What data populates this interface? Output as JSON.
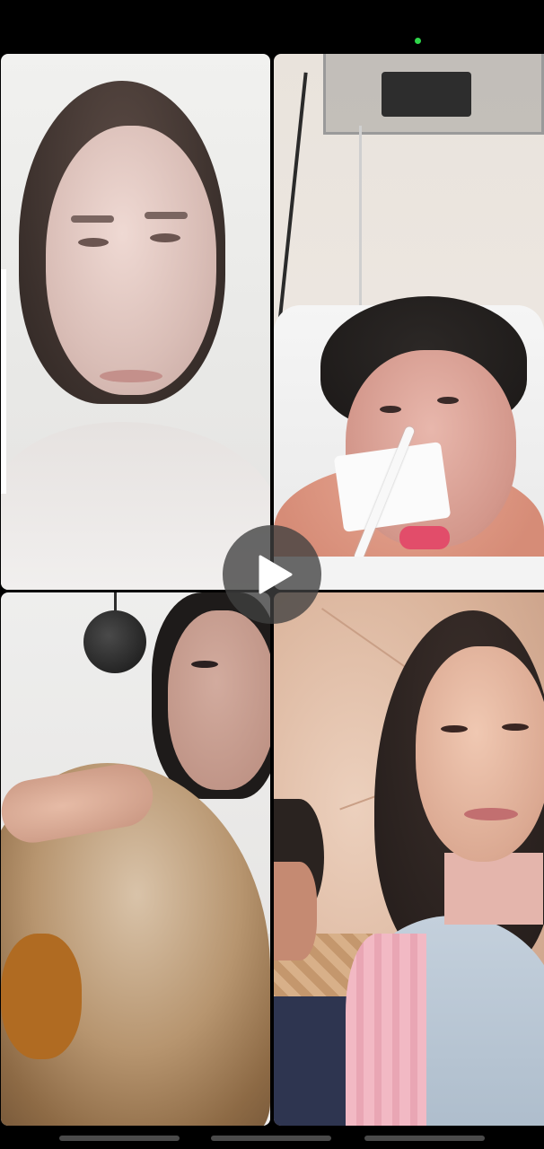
{
  "call": {
    "participants": [
      {
        "position": "top-left"
      },
      {
        "position": "top-right"
      },
      {
        "position": "bottom-left"
      },
      {
        "position": "bottom-right"
      }
    ],
    "camera_indicator_color": "#2fd64a"
  },
  "player": {
    "play_icon": "play-icon",
    "overlay_color": "#404040"
  },
  "indicators": {
    "count": 3
  }
}
